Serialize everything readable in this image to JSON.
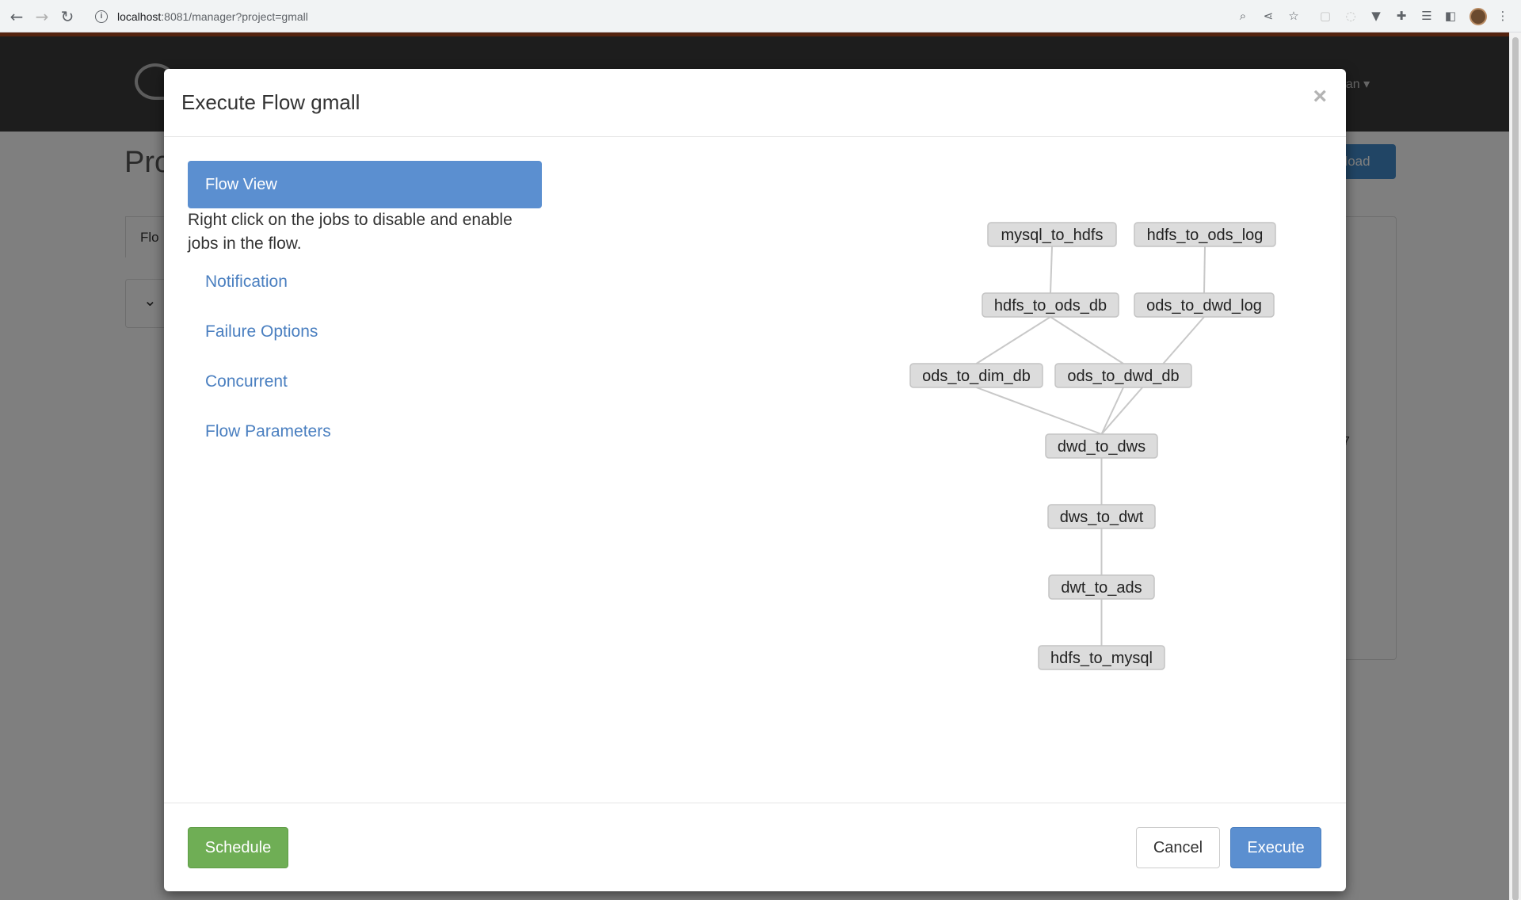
{
  "browser": {
    "url_host": "localhost",
    "url_rest": ":8081/manager?project=gmall"
  },
  "background_page": {
    "title_fragment": "Pro",
    "user_fragment": "pan ▾",
    "download_fragment": "nload",
    "tab_fragment": "Flo",
    "stray_text": "7"
  },
  "modal": {
    "title": "Execute Flow gmall",
    "close_symbol": "×",
    "sidebar": {
      "active_label": "Flow View",
      "help_text": "Right click on the jobs to disable and enable jobs in the flow.",
      "items": [
        {
          "label": "Notification"
        },
        {
          "label": "Failure Options"
        },
        {
          "label": "Concurrent"
        },
        {
          "label": "Flow Parameters"
        }
      ]
    },
    "flow": {
      "nodes": [
        {
          "id": "mysql_to_hdfs",
          "label": "mysql_to_hdfs"
        },
        {
          "id": "hdfs_to_ods_log",
          "label": "hdfs_to_ods_log"
        },
        {
          "id": "hdfs_to_ods_db",
          "label": "hdfs_to_ods_db"
        },
        {
          "id": "ods_to_dwd_log",
          "label": "ods_to_dwd_log"
        },
        {
          "id": "ods_to_dim_db",
          "label": "ods_to_dim_db"
        },
        {
          "id": "ods_to_dwd_db",
          "label": "ods_to_dwd_db"
        },
        {
          "id": "dwd_to_dws",
          "label": "dwd_to_dws"
        },
        {
          "id": "dws_to_dwt",
          "label": "dws_to_dwt"
        },
        {
          "id": "dwt_to_ads",
          "label": "dwt_to_ads"
        },
        {
          "id": "hdfs_to_mysql",
          "label": "hdfs_to_mysql"
        }
      ],
      "edges": [
        [
          "mysql_to_hdfs",
          "hdfs_to_ods_db"
        ],
        [
          "hdfs_to_ods_log",
          "ods_to_dwd_log"
        ],
        [
          "hdfs_to_ods_db",
          "ods_to_dim_db"
        ],
        [
          "hdfs_to_ods_db",
          "ods_to_dwd_db"
        ],
        [
          "ods_to_dim_db",
          "dwd_to_dws"
        ],
        [
          "ods_to_dwd_db",
          "dwd_to_dws"
        ],
        [
          "ods_to_dwd_log",
          "dwd_to_dws"
        ],
        [
          "dwd_to_dws",
          "dws_to_dwt"
        ],
        [
          "dws_to_dwt",
          "dwt_to_ads"
        ],
        [
          "dwt_to_ads",
          "hdfs_to_mysql"
        ]
      ]
    },
    "footer": {
      "schedule_label": "Schedule",
      "cancel_label": "Cancel",
      "execute_label": "Execute"
    }
  },
  "colors": {
    "primary": "#5b8fd0",
    "success": "#6fae55",
    "link": "#4a7fc0",
    "node_fill": "#dcdcdc"
  }
}
